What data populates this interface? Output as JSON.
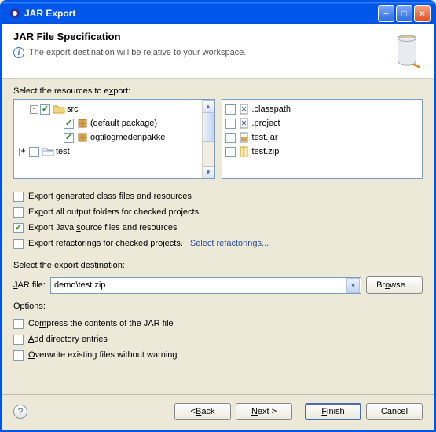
{
  "window": {
    "title": "JAR Export"
  },
  "banner": {
    "title": "JAR File Specification",
    "message": "The export destination will be relative to your workspace."
  },
  "resources": {
    "label_pre": "Select the resources to e",
    "label_u": "x",
    "label_post": "port:",
    "tree": [
      {
        "indent": 14,
        "expander": "-",
        "checked": true,
        "icon": "folder-src",
        "text": "src"
      },
      {
        "indent": 44,
        "expander": "",
        "checked": true,
        "icon": "package",
        "text": "(default package)"
      },
      {
        "indent": 44,
        "expander": "",
        "checked": true,
        "icon": "package",
        "text": "ogtilogmedenpakke"
      },
      {
        "indent": 0,
        "expander": "+",
        "checked": false,
        "icon": "folder-test",
        "text": "test"
      }
    ],
    "files": [
      {
        "checked": false,
        "icon": "file-x",
        "text": ".classpath"
      },
      {
        "checked": false,
        "icon": "file-x",
        "text": ".project"
      },
      {
        "checked": false,
        "icon": "file-jar",
        "text": "test.jar"
      },
      {
        "checked": false,
        "icon": "file-zip",
        "text": "test.zip"
      }
    ]
  },
  "export_options": [
    {
      "checked": false,
      "pre": "Export generated class files and resour",
      "u": "c",
      "post": "es"
    },
    {
      "checked": false,
      "pre": "Ex",
      "u": "p",
      "post": "ort all output folders for checked projects"
    },
    {
      "checked": true,
      "pre": "Export Java ",
      "u": "s",
      "post": "ource files and resources"
    },
    {
      "checked": false,
      "pre": "",
      "u": "E",
      "post": "xport refactorings for checked projects.",
      "link": "Select refactorings..."
    }
  ],
  "destination": {
    "section_label": "Select the export destination:",
    "field_pre": "",
    "field_u": "J",
    "field_post": "AR file:",
    "value": "demo\\test.zip",
    "browse_pre": "Br",
    "browse_u": "o",
    "browse_post": "wse..."
  },
  "options": {
    "label": "Options:",
    "rows": [
      {
        "checked": false,
        "pre": "Co",
        "u": "m",
        "post": "press the contents of the JAR file"
      },
      {
        "checked": false,
        "pre": "",
        "u": "A",
        "post": "dd directory entries"
      },
      {
        "checked": false,
        "pre": "",
        "u": "O",
        "post": "verwrite existing files without warning"
      }
    ]
  },
  "footer": {
    "back_pre": "< ",
    "back_u": "B",
    "back_post": "ack",
    "next_pre": "",
    "next_u": "N",
    "next_post": "ext >",
    "finish_pre": "",
    "finish_u": "F",
    "finish_post": "inish",
    "cancel": "Cancel"
  }
}
